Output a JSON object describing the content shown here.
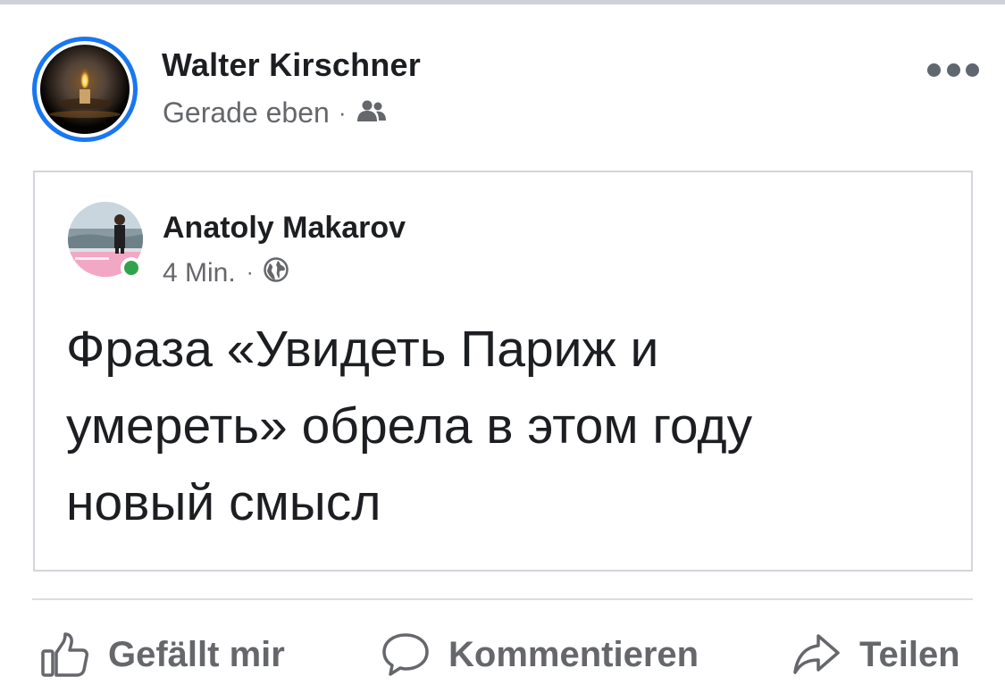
{
  "post": {
    "author": "Walter Kirschner",
    "timestamp": "Gerade eben",
    "separator": "·",
    "audience_icon": "friends-icon",
    "more_icon": "more-horizontal-icon"
  },
  "shared_post": {
    "author": "Anatoly Makarov",
    "timestamp": "4 Min.",
    "separator": "·",
    "audience_icon": "globe-icon",
    "online_status_color": "#31a24c",
    "lines": [
      "Фраза «Увидеть Париж и",
      "умереть» обрела в этом году",
      "новый смысл"
    ]
  },
  "actions": {
    "like": {
      "label": "Gefällt mir",
      "icon": "thumbs-up-icon"
    },
    "comment": {
      "label": "Kommentieren",
      "icon": "comment-icon"
    },
    "share": {
      "label": "Teilen",
      "icon": "share-arrow-icon"
    }
  },
  "colors": {
    "avatar_ring": "#1877f2",
    "secondary_text": "#65676b",
    "primary_text": "#1c1e21"
  }
}
